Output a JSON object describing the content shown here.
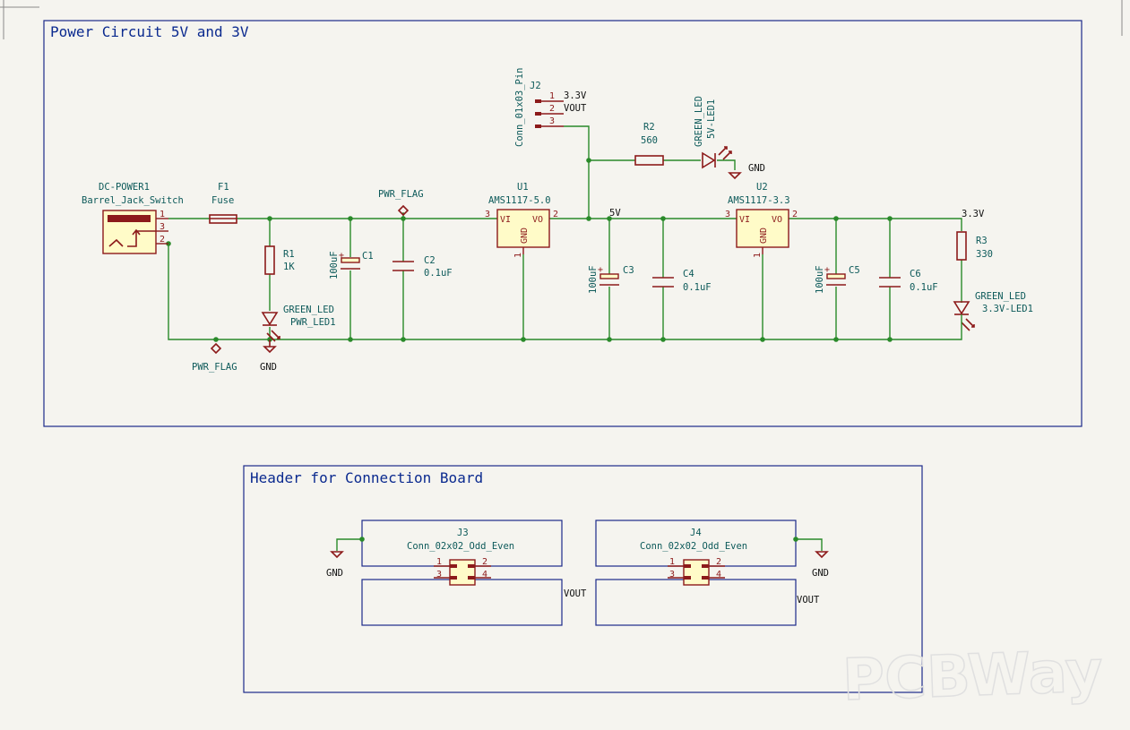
{
  "sections": {
    "power_title": "Power Circuit 5V and 3V",
    "header_title": "Header for Connection Board"
  },
  "components": {
    "dc_power": {
      "ref": "DC-POWER1",
      "value": "Barrel_Jack_Switch",
      "pins": [
        "1",
        "3",
        "2"
      ]
    },
    "f1": {
      "ref": "F1",
      "value": "Fuse"
    },
    "pwr_flag_top": {
      "label": "PWR_FLAG"
    },
    "pwr_flag_bottom": {
      "label": "PWR_FLAG"
    },
    "r1": {
      "ref": "R1",
      "value": "1K"
    },
    "pwr_led": {
      "value": "GREEN_LED",
      "ref": "PWR_LED1"
    },
    "c1": {
      "ref": "C1",
      "value": "100uF"
    },
    "c2": {
      "ref": "C2",
      "value": "0.1uF"
    },
    "u1": {
      "ref": "U1",
      "value": "AMS1117-5.0",
      "vi": "VI",
      "vo": "VO",
      "gnd": "GND",
      "pin_in": "3",
      "pin_out": "2",
      "pin_gnd": "1"
    },
    "j2": {
      "ref": "J2",
      "value": "Conn_01x03_Pin",
      "pins": [
        "1",
        "2",
        "3"
      ],
      "nets": [
        "3.3V",
        "VOUT"
      ]
    },
    "r2": {
      "ref": "R2",
      "value": "560"
    },
    "led_5v": {
      "value": "GREEN_LED",
      "ref": "5V-LED1"
    },
    "c3": {
      "ref": "C3",
      "value": "100uF"
    },
    "c4": {
      "ref": "C4",
      "value": "0.1uF"
    },
    "u2": {
      "ref": "U2",
      "value": "AMS1117-3.3",
      "vi": "VI",
      "vo": "VO",
      "gnd": "GND",
      "pin_in": "3",
      "pin_out": "2",
      "pin_gnd": "1"
    },
    "c5": {
      "ref": "C5",
      "value": "100uF"
    },
    "c6": {
      "ref": "C6",
      "value": "0.1uF"
    },
    "r3": {
      "ref": "R3",
      "value": "330"
    },
    "led_3v3": {
      "value": "GREEN_LED",
      "ref": "3.3V-LED1"
    },
    "j3": {
      "ref": "J3",
      "value": "Conn_02x02_Odd_Even",
      "pins": [
        "1",
        "2",
        "3",
        "4"
      ]
    },
    "j4": {
      "ref": "J4",
      "value": "Conn_02x02_Odd_Even",
      "pins": [
        "1",
        "2",
        "3",
        "4"
      ]
    }
  },
  "nets": {
    "gnd": "GND",
    "v5": "5V",
    "v33": "3.3V",
    "vout": "VOUT"
  },
  "watermark": "PCBWay",
  "colors": {
    "background": "#f5f4ef",
    "wire": "#2a8a2a",
    "component": "#8c1a1a",
    "component_fill": "#fffbc8",
    "sheet_border": "#1b2a8a",
    "label_text": "#0d5a5a"
  }
}
